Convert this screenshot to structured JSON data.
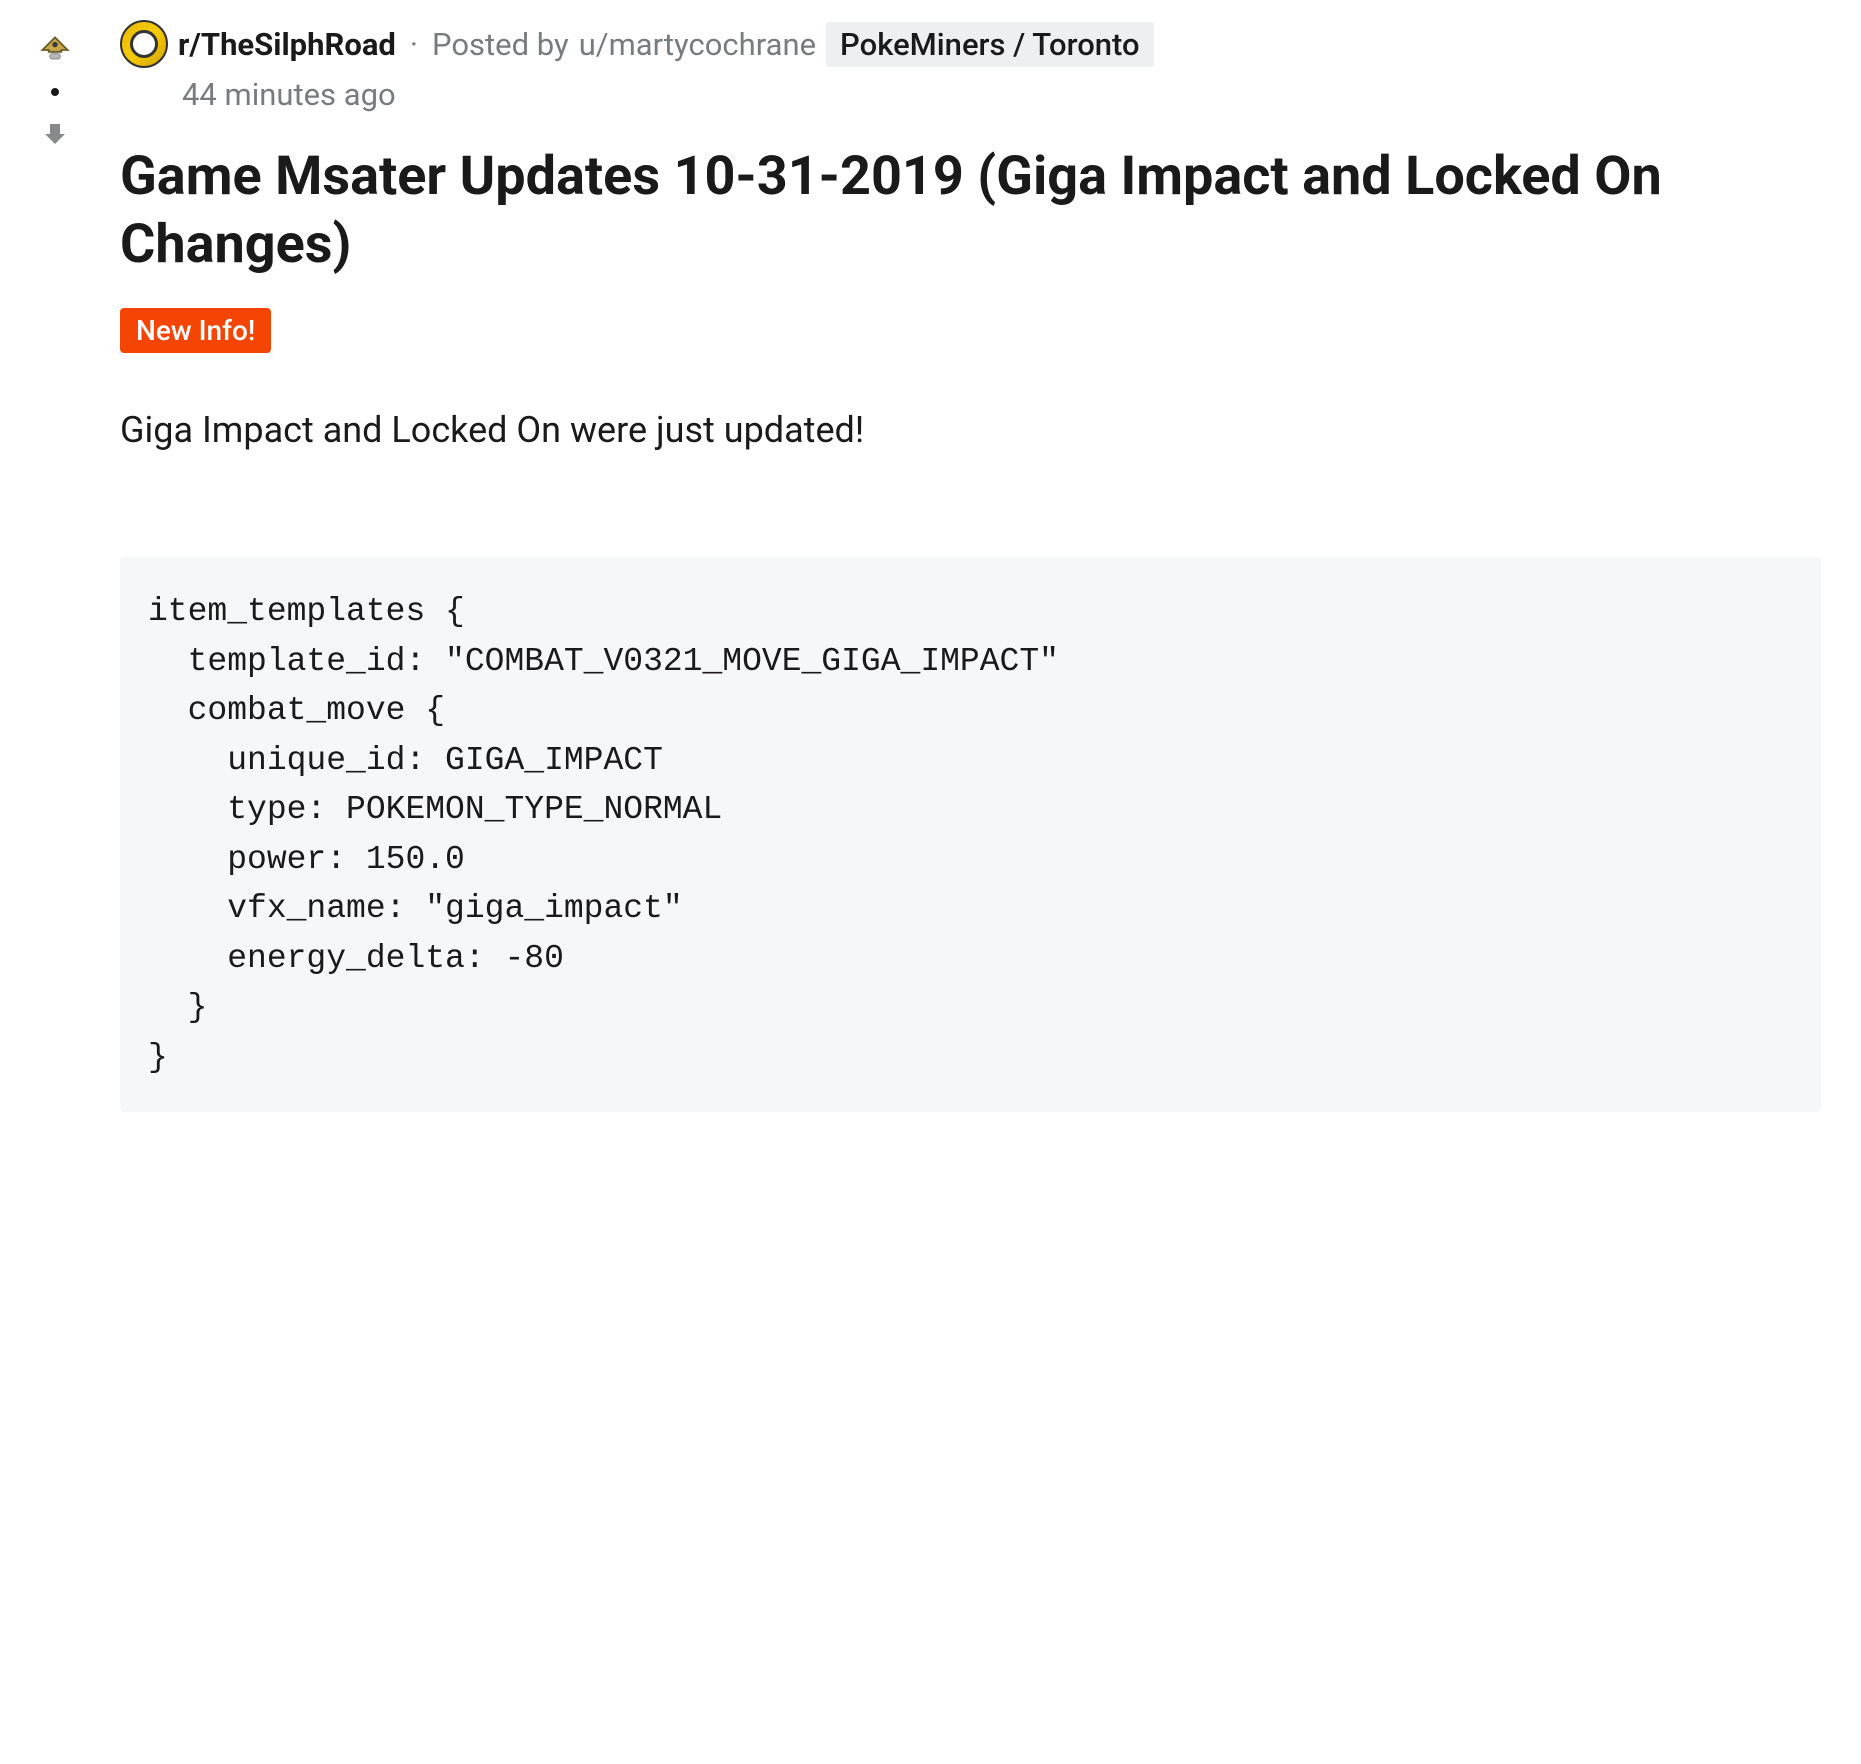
{
  "header": {
    "subreddit": "r/TheSilphRoad",
    "posted_by_prefix": "Posted by ",
    "username": "u/martycochrane",
    "user_flair": "PokeMiners / Toronto",
    "timestamp": "44 minutes ago"
  },
  "post": {
    "title": "Game Msater Updates 10-31-2019 (Giga Impact and Locked On Changes)",
    "flair": "New Info!",
    "body_text": "Giga Impact and Locked On were just updated!",
    "code": "item_templates {\n  template_id: \"COMBAT_V0321_MOVE_GIGA_IMPACT\"\n  combat_move {\n    unique_id: GIGA_IMPACT\n    type: POKEMON_TYPE_NORMAL\n    power: 150.0\n    vfx_name: \"giga_impact\"\n    energy_delta: -80\n  }\n}"
  },
  "colors": {
    "flair_bg": "#f54504",
    "code_bg": "#f6f7f8",
    "muted_text": "#787c7e"
  }
}
